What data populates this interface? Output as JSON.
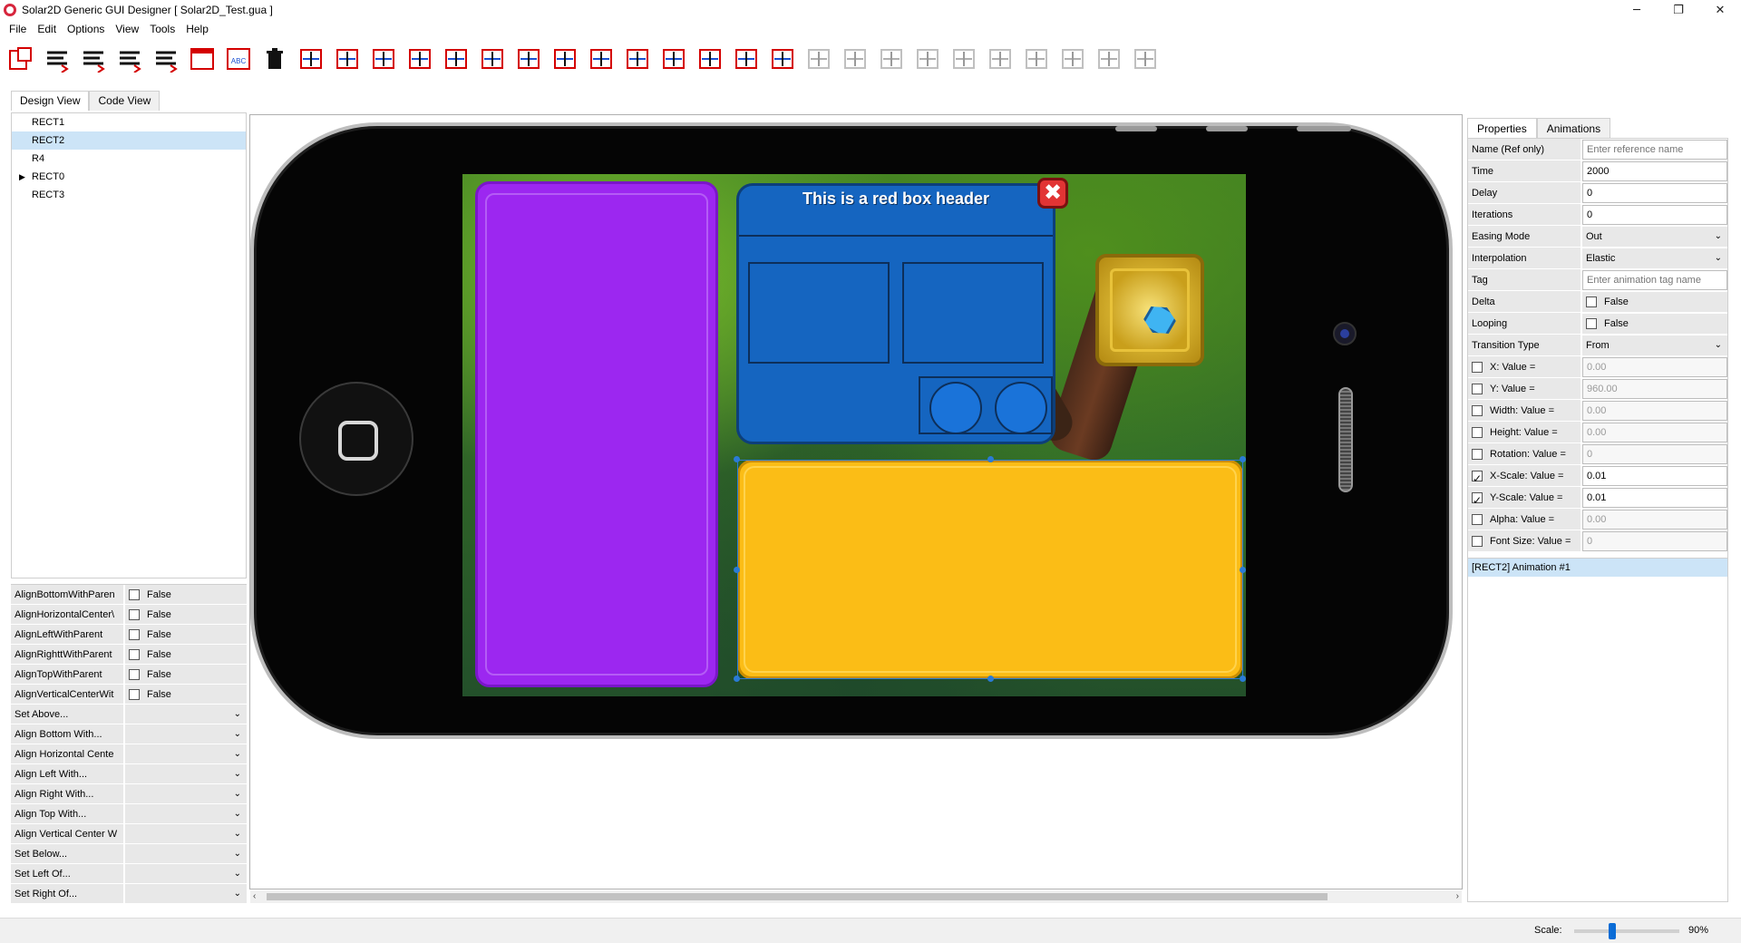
{
  "window": {
    "title": "Solar2D Generic GUI Designer [ Solar2D_Test.gua ]",
    "controls": [
      "─",
      "❐",
      "✕"
    ]
  },
  "menu": [
    "File",
    "Edit",
    "Options",
    "View",
    "Tools",
    "Help"
  ],
  "toolbar": [
    "new-rect-icon",
    "align-left-text-icon",
    "align-center-text-icon",
    "align-right-text-icon",
    "align-justify-text-icon",
    "window-icon",
    "text-field-icon",
    "trash-icon",
    "distribute-h-icon",
    "distribute-v-icon",
    "align-left-icon",
    "align-top-icon",
    "align-right-icon",
    "align-bottom-icon",
    "center-h-icon",
    "center-v-icon",
    "stack-left-icon",
    "stack-top-icon",
    "expand-icon",
    "shrink-icon",
    "same-height-icon",
    "same-width-icon",
    "disabled-align-left-icon",
    "disabled-align-top-icon",
    "disabled-align-right-icon",
    "disabled-align-bottom-icon",
    "disabled-center-h-icon",
    "disabled-center-v-icon",
    "disabled-anchor-1-icon",
    "disabled-anchor-2-icon",
    "disabled-anchor-3-icon",
    "disabled-anchor-4-icon"
  ],
  "left_tabs": [
    "Design View",
    "Code View"
  ],
  "tree": [
    {
      "label": "RECT1",
      "selected": false,
      "expandable": false
    },
    {
      "label": "RECT2",
      "selected": true,
      "expandable": false
    },
    {
      "label": "R4",
      "selected": false,
      "expandable": false
    },
    {
      "label": "RECT0",
      "selected": false,
      "expandable": true
    },
    {
      "label": "RECT3",
      "selected": false,
      "expandable": false
    }
  ],
  "align_props": [
    {
      "label": "AlignBottomWithParen",
      "value": "False"
    },
    {
      "label": "AlignHorizontalCenter\\",
      "value": "False"
    },
    {
      "label": "AlignLeftWithParent",
      "value": "False"
    },
    {
      "label": "AlignRighttWithParent",
      "value": "False"
    },
    {
      "label": "AlignTopWithParent",
      "value": "False"
    },
    {
      "label": "AlignVerticalCenterWit",
      "value": "False"
    }
  ],
  "align_dropdowns": [
    "Set Above...",
    "Align Bottom With...",
    "Align Horizontal Cente",
    "Align Left With...",
    "Align Right With...",
    "Align Top With...",
    "Align Vertical Center W",
    "Set Below...",
    "Set Left Of...",
    "Set Right Of..."
  ],
  "canvas": {
    "header_text": "This is a red box header",
    "close_glyph": "✖"
  },
  "right_tabs": [
    "Properties",
    "Animations"
  ],
  "animation_props": {
    "name_label": "Name (Ref only)",
    "name_placeholder": "Enter reference name",
    "time_label": "Time",
    "time_value": "2000",
    "delay_label": "Delay",
    "delay_value": "0",
    "iterations_label": "Iterations",
    "iterations_value": "0",
    "easing_label": "Easing Mode",
    "easing_value": "Out",
    "interp_label": "Interpolation",
    "interp_value": "Elastic",
    "tag_label": "Tag",
    "tag_placeholder": "Enter animation tag name",
    "delta_label": "Delta",
    "delta_value": "False",
    "looping_label": "Looping",
    "looping_value": "False",
    "transition_label": "Transition Type",
    "transition_value": "From"
  },
  "value_props": [
    {
      "label": "X: Value =",
      "value": "0.00",
      "checked": false
    },
    {
      "label": "Y: Value =",
      "value": "960.00",
      "checked": false
    },
    {
      "label": "Width: Value =",
      "value": "0.00",
      "checked": false
    },
    {
      "label": "Height: Value =",
      "value": "0.00",
      "checked": false
    },
    {
      "label": "Rotation: Value =",
      "value": "0",
      "checked": false
    },
    {
      "label": "X-Scale: Value =",
      "value": "0.01",
      "checked": true
    },
    {
      "label": "Y-Scale: Value =",
      "value": "0.01",
      "checked": true
    },
    {
      "label": "Alpha: Value =",
      "value": "0.00",
      "checked": false
    },
    {
      "label": "Font Size: Value =",
      "value": "0",
      "checked": false
    }
  ],
  "animation_list": [
    "[RECT2] Animation #1"
  ],
  "status": {
    "scale_label": "Scale:",
    "scale_value": "90%",
    "scale_fraction": 0.35
  }
}
